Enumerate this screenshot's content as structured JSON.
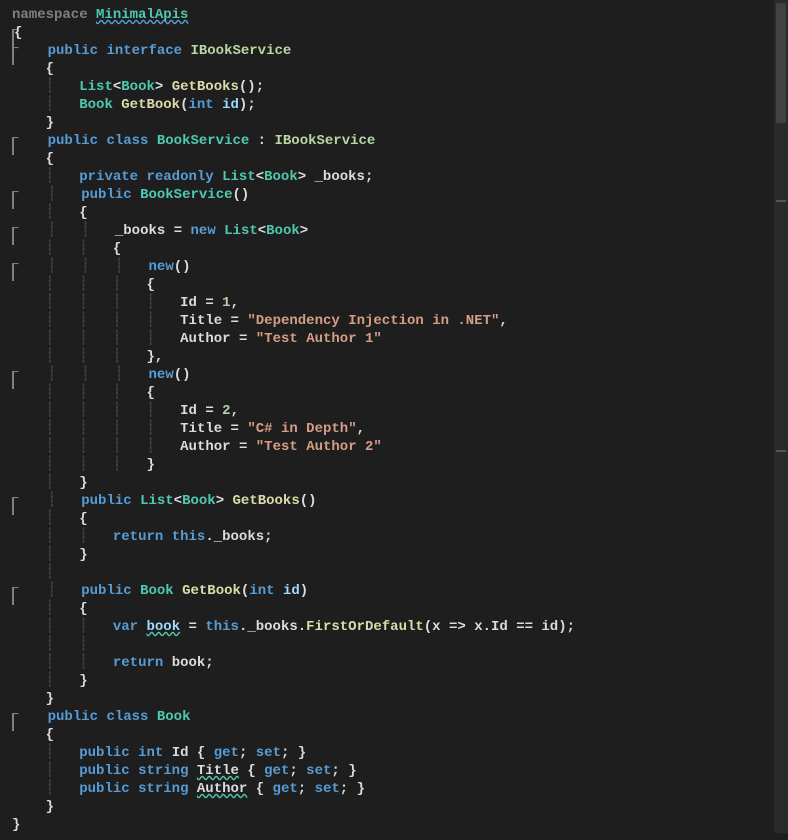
{
  "code": {
    "l01_ns": "namespace",
    "l01_name": "MinimalApis",
    "l02_brace": "{",
    "l03_pub": "public",
    "l03_iface": "interface",
    "l03_name": "IBookService",
    "l04_brace": "{",
    "l05_list": "List",
    "l05_book": "Book",
    "l05_get": "GetBooks",
    "l05_paren": "();",
    "l06_book": "Book",
    "l06_get": "GetBook",
    "l06_int": "int",
    "l06_id": "id",
    "l06_paren": ");",
    "l07_brace": "}",
    "l08_pub": "public",
    "l08_class": "class",
    "l08_name": "BookService",
    "l08_colon": " : ",
    "l08_iface": "IBookService",
    "l09_brace": "{",
    "l10_priv": "private",
    "l10_ro": "readonly",
    "l10_list": "List",
    "l10_book": "Book",
    "l10_field": "_books",
    "l10_semi": ";",
    "l11_pub": "public",
    "l11_ctor": "BookService",
    "l11_paren": "()",
    "l12_brace": "{",
    "l13_field": "_books",
    "l13_eq": " = ",
    "l13_new": "new",
    "l13_list": "List",
    "l13_book": "Book",
    "l13_gt": ">",
    "l14_brace": "{",
    "l15_new": "new",
    "l15_paren": "()",
    "l16_brace": "{",
    "l17_id": "Id",
    "l17_eq": " = ",
    "l17_val": "1",
    "l17_comma": ",",
    "l18_title": "Title",
    "l18_eq": " = ",
    "l18_val": "\"Dependency Injection in .NET\"",
    "l18_comma": ",",
    "l19_auth": "Author",
    "l19_eq": " = ",
    "l19_val": "\"Test Author 1\"",
    "l20_brace": "},",
    "l21_new": "new",
    "l21_paren": "()",
    "l22_brace": "{",
    "l23_id": "Id",
    "l23_eq": " = ",
    "l23_val": "2",
    "l23_comma": ",",
    "l24_title": "Title",
    "l24_eq": " = ",
    "l24_val": "\"C# in Depth\"",
    "l24_comma": ",",
    "l25_auth": "Author",
    "l25_eq": " = ",
    "l25_val": "\"Test Author 2\"",
    "l26_brace": "}",
    "l27_brace": "}",
    "l28_pub": "public",
    "l28_list": "List",
    "l28_book": "Book",
    "l28_get": "GetBooks",
    "l28_paren": "()",
    "l29_brace": "{",
    "l30_ret": "return",
    "l30_this": "this",
    "l30_field": "._books;",
    "l31_brace": "}",
    "l33_pub": "public",
    "l33_book": "Book",
    "l33_get": "GetBook",
    "l33_int": "int",
    "l33_id": "id",
    "l33_paren": ")",
    "l34_brace": "{",
    "l35_var": "var",
    "l35_book": "book",
    "l35_eq": " = ",
    "l35_this": "this",
    "l35_field": "._books.",
    "l35_fod": "FirstOrDefault",
    "l35_lambda1": "(x => x.Id == id);",
    "l37_ret": "return",
    "l37_book": " book;",
    "l38_brace": "}",
    "l39_brace": "}",
    "l40_pub": "public",
    "l40_class": "class",
    "l40_name": "Book",
    "l41_brace": "{",
    "l42_pub": "public",
    "l42_int": "int",
    "l42_id": "Id",
    "l42_acc": " { ",
    "l42_get": "get",
    "l42_sep": "; ",
    "l42_set": "set",
    "l42_end": "; }",
    "l43_pub": "public",
    "l43_str": "string",
    "l43_title": "Title",
    "l43_acc": " { ",
    "l43_get": "get",
    "l43_sep": "; ",
    "l43_set": "set",
    "l43_end": "; }",
    "l44_pub": "public",
    "l44_str": "string",
    "l44_auth": "Author",
    "l44_acc": " { ",
    "l44_get": "get",
    "l44_sep": "; ",
    "l44_set": "set",
    "l44_end": "; }",
    "l45_brace": "}",
    "l46_brace": "}"
  }
}
